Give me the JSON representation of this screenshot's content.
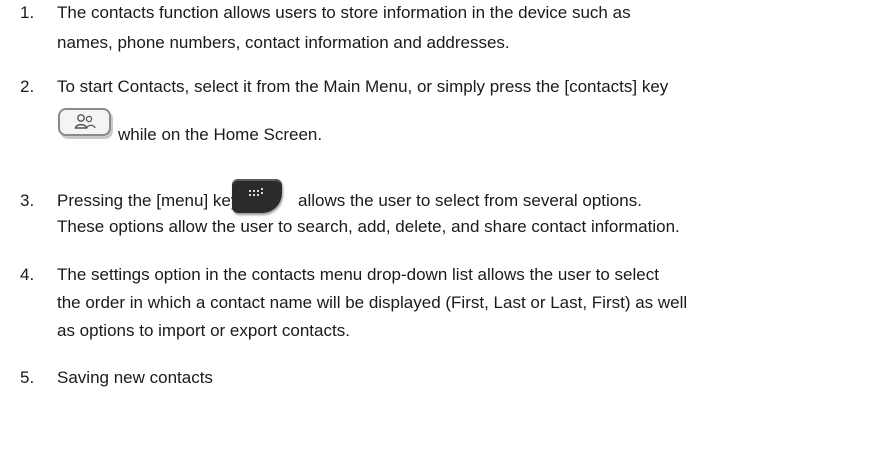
{
  "list": {
    "items": [
      {
        "number": "1.",
        "lines": [
          "The contacts function allows users to store information in the device such as",
          "names, phone numbers, contact information and addresses."
        ]
      },
      {
        "number": "2.",
        "lines": [
          "To start Contacts, select it from the Main Menu, or simply press the [contacts] key",
          "while on the Home Screen."
        ]
      },
      {
        "number": "3.",
        "lines": [
          "Pressing the [menu] key",
          "allows the user to select from several options.",
          "These options allow the user to search, add, delete, and share contact information."
        ]
      },
      {
        "number": "4.",
        "lines": [
          "The settings option in the contacts menu drop-down list allows the user to select",
          "the order in which a contact name will be displayed (First, Last or Last, First) as well",
          "as options to import or export contacts."
        ]
      },
      {
        "number": "5.",
        "lines": [
          "Saving new contacts"
        ]
      }
    ]
  },
  "icons": {
    "contacts_key": "contacts-key-icon",
    "menu_key": "menu-key-icon"
  },
  "colors": {
    "text": "#1a1a1a",
    "menu_key": "#2b2b2b",
    "contacts_key_border": "#8a8a8a"
  }
}
